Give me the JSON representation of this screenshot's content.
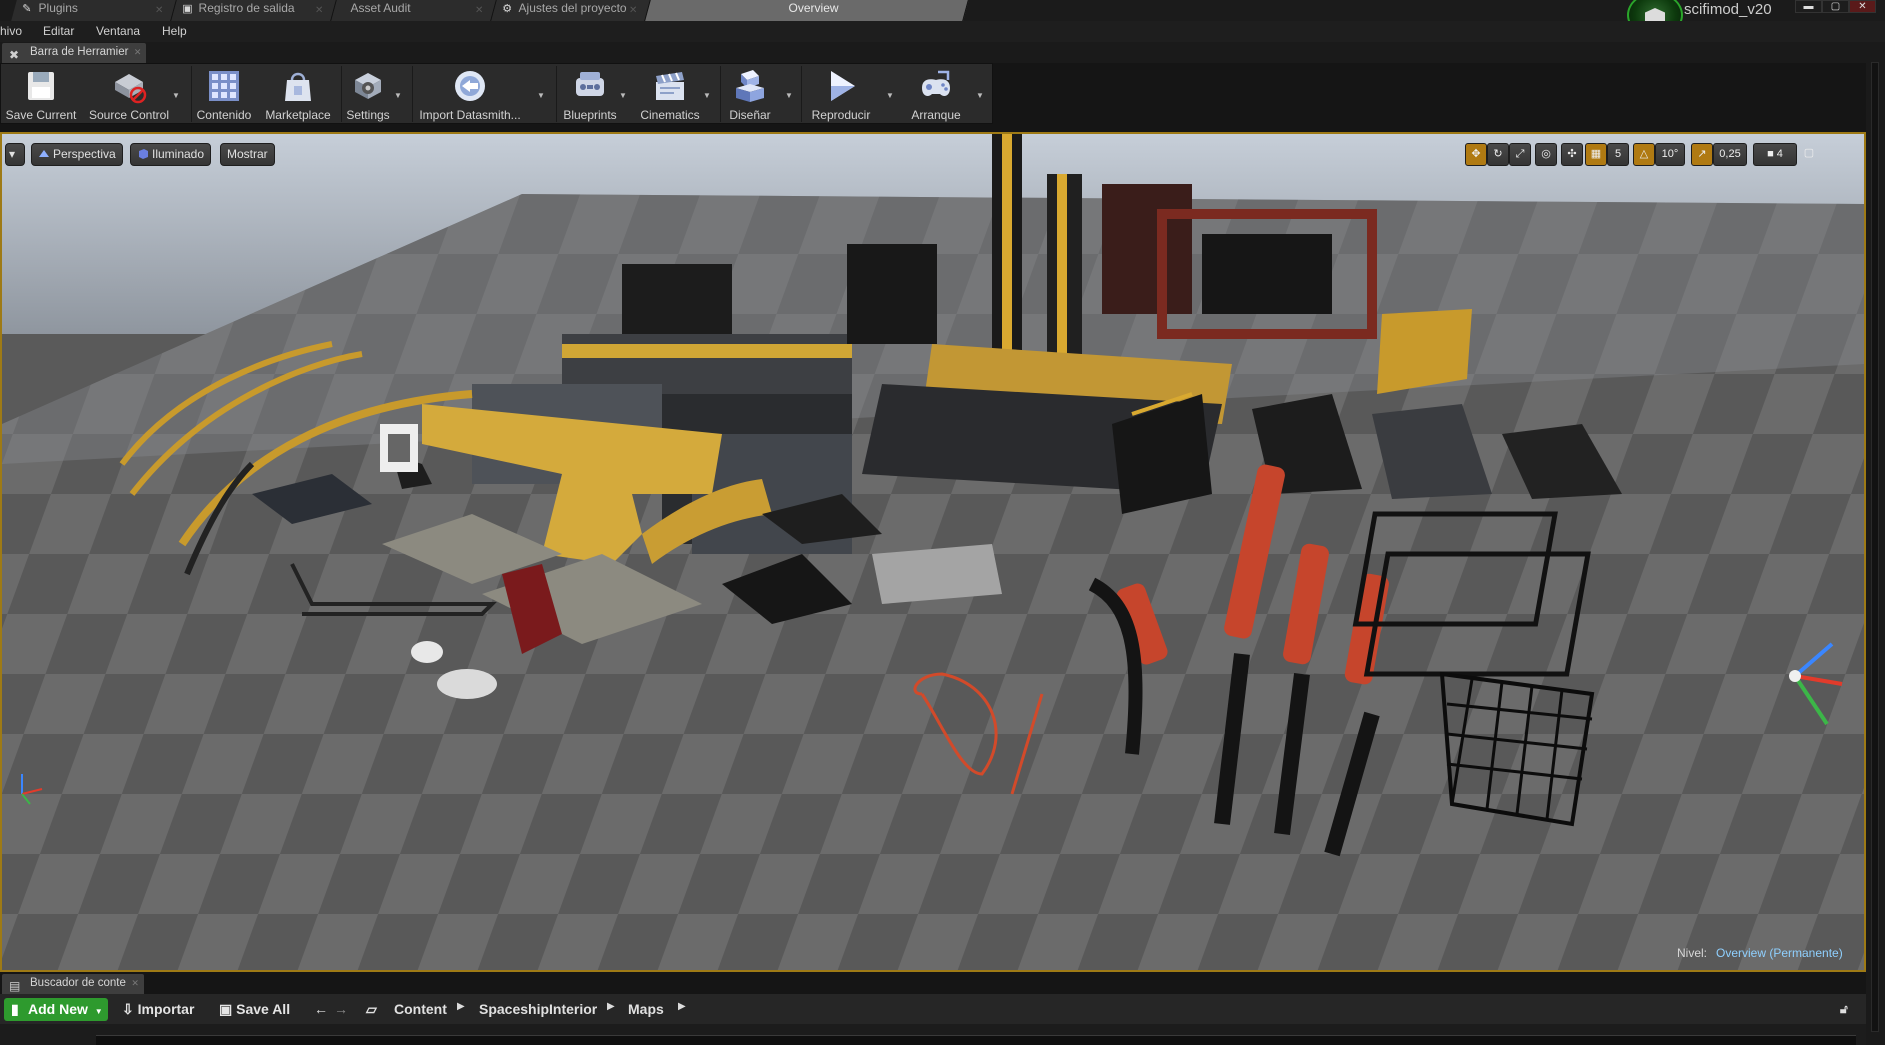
{
  "tabs": [
    {
      "label": "Plugins",
      "icon": "plug-icon"
    },
    {
      "label": "Registro de salida",
      "icon": "log-icon"
    },
    {
      "label": "Asset Audit",
      "icon": ""
    },
    {
      "label": "Ajustes del proyecto",
      "icon": "settings-gear-icon"
    },
    {
      "label": "Overview",
      "icon": ""
    }
  ],
  "project": {
    "name": "scifimod_v20"
  },
  "window_controls": {
    "minimize": "▬",
    "maximize": "▢",
    "close": "✕"
  },
  "menu": [
    "hivo",
    "Editar",
    "Ventana",
    "Help"
  ],
  "toolbar_panel_tab": {
    "label": "Barra de Herramier"
  },
  "toolbar": {
    "save_current": "Save Current",
    "source_control": "Source Control",
    "contenido": "Contenido",
    "marketplace": "Marketplace",
    "settings": "Settings",
    "import_datasmith": "Import Datasmith...",
    "blueprints": "Blueprints",
    "cinematics": "Cinematics",
    "disenar": "Diseñar",
    "reproducir": "Reproducir",
    "arranque": "Arranque"
  },
  "viewport": {
    "view_mode": "Perspectiva",
    "lighting": "Iluminado",
    "show": "Mostrar",
    "grid_snap": "5",
    "rotation_snap": "10°",
    "scale_snap": "0,25",
    "camera_speed": "4",
    "level_label": "Nivel:",
    "level_value": "Overview (Permanente)"
  },
  "content_browser": {
    "tab_label": "Buscador de conte",
    "add_new": "Add New",
    "import": "Importar",
    "save_all": "Save All",
    "breadcrumbs": [
      "Content",
      "SpaceshipInterior",
      "Maps"
    ]
  },
  "colors": {
    "accent_gold": "#b07a12",
    "add_new_green": "#2e9a2e",
    "level_link": "#8fd0ff"
  }
}
